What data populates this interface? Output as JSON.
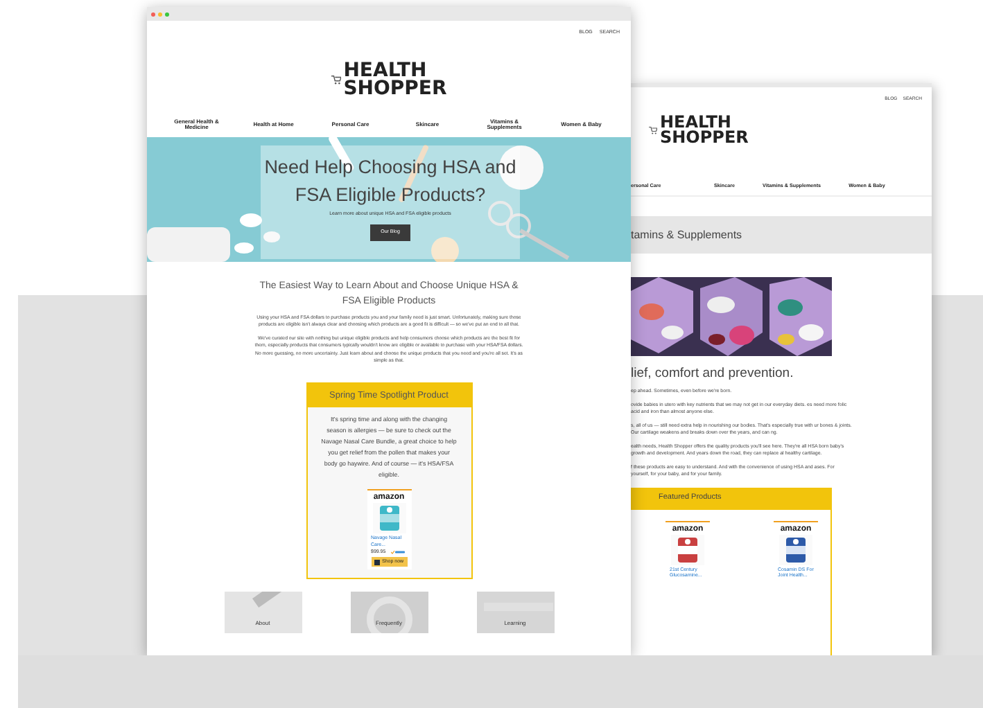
{
  "front_window": {
    "header_links": [
      "BLOG",
      "SEARCH"
    ],
    "logo": {
      "line_1": "HEALTH",
      "line_2": "SHOPPER"
    },
    "nav": [
      "General Health & Medicine",
      "Health at Home",
      "Personal Care",
      "Skincare",
      "Vitamins & Supplements",
      "Women & Baby"
    ],
    "hero": {
      "title": "Need Help Choosing HSA and FSA Eligible Products?",
      "subtitle": "Learn more about unique HSA and FSA eligible products",
      "button": "Our Blog"
    },
    "intro": {
      "heading": "The Easiest Way to Learn About and Choose Unique HSA & FSA Eligible Products",
      "paragraphs": [
        "Using your HSA and FSA dollars to purchase products you and your family need is just smart. Unfortunately, making sure those products are eligible isn't always clear and choosing which products are a good fit is difficult — so we've put an end to all that.",
        "We've curated our site with nothing but unique eligible products and help consumers choose which products are the best fit for them, especially products that consumers typically wouldn't know are eligible or available to purchase with your HSA/FSA dollars. No more guessing, no more uncertainty. Just learn about and choose the unique products that you need and you're all set. It's as simple as that."
      ]
    },
    "spotlight": {
      "title": "Spring Time Spotlight Product",
      "text": "It's spring time and along with the changing season is allergies — be sure to check out the Navage Nasal Care Bundle, a great choice to help you get relief from the pollen that makes your body go haywire. And of course — it's HSA/FSA eligible.",
      "product": {
        "store": "amazon",
        "name": "Navage Nasal Care...",
        "price": "$99.95",
        "button": "Shop now"
      }
    },
    "cards": [
      "About",
      "Frequently",
      "Learning"
    ]
  },
  "back_window": {
    "header_links": [
      "BLOG",
      "SEARCH"
    ],
    "logo": {
      "line_1": "HEALTH",
      "line_2": "SHOPPER"
    },
    "nav": [
      "ersonal Care",
      "Skincare",
      "Vitamins & Supplements",
      "Women & Baby"
    ],
    "page_title": "tamins & Supplements",
    "heading": "lief, comfort and prevention.",
    "paragraphs": [
      "ep ahead. Sometimes, even before we're born.",
      "ovide babies in utero with key nutrients that we may not get in our everyday diets. es need more folic acid and iron than almost anyone else.",
      "s, all of us — still need extra help in nourishing our bodies. That's especially true with ur bones & joints. Our cartilage weakens and breaks down over the years, and can ng.",
      "ealth needs, Health Shopper offers the quality products you'll see here. They're all HSA born baby's growth and development. And years down the road, they can replace al healthy cartilage.",
      "f these products are easy to understand. And with the convenience of using HSA and ases. For yourself, for your baby, and for your family."
    ],
    "featured": {
      "title": "Featured Products",
      "products": [
        {
          "store": "amazon",
          "name": "21st Century Glucosamine..."
        },
        {
          "store": "amazon",
          "name": "Cosamin DS For Joint Health..."
        }
      ]
    }
  }
}
